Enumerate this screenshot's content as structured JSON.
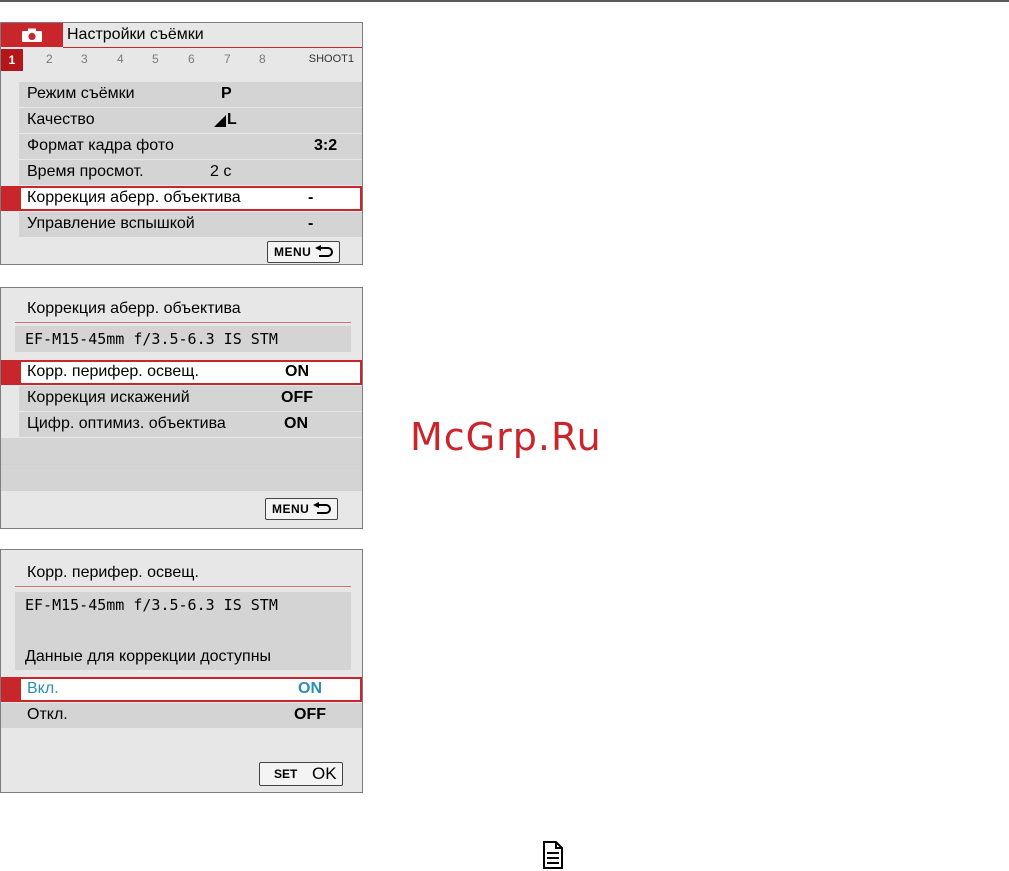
{
  "panel1": {
    "title": "Настройки съёмки",
    "tab_numbers": [
      "1",
      "2",
      "3",
      "4",
      "5",
      "6",
      "7",
      "8"
    ],
    "tab_label": "SHOOT1",
    "rows": [
      {
        "label": "Режим съёмки",
        "value": "P"
      },
      {
        "label": "Качество",
        "value": "L"
      },
      {
        "label": "Формат кадра фото",
        "value": "3:2"
      },
      {
        "label": "Время просмот.",
        "value": "2 с"
      },
      {
        "label": "Коррекция аберр. объектива",
        "value": "-"
      },
      {
        "label": "Управление вспышкой",
        "value": "-"
      }
    ],
    "menu_button": "MENU"
  },
  "panel2": {
    "title": "Коррекция аберр. объектива",
    "lens": "EF-M15-45mm f/3.5-6.3 IS STM",
    "rows": [
      {
        "label": "Корр. перифер. освещ.",
        "value": "ON"
      },
      {
        "label": "Коррекция искажений",
        "value": "OFF"
      },
      {
        "label": "Цифр. оптимиз. объектива",
        "value": "ON"
      }
    ],
    "menu_button": "MENU"
  },
  "panel3": {
    "title": "Корр. перифер. освещ.",
    "lens": "EF-M15-45mm f/3.5-6.3 IS STM",
    "info": "Данные для коррекции доступны",
    "options": [
      {
        "label": "Вкл.",
        "value": "ON"
      },
      {
        "label": "Откл.",
        "value": "OFF"
      }
    ],
    "set_label": "SET",
    "ok_label": "OK"
  },
  "watermark": "McGrp.Ru",
  "colors": {
    "accent": "#c8262a",
    "selected_option": "#2a8fb5"
  }
}
